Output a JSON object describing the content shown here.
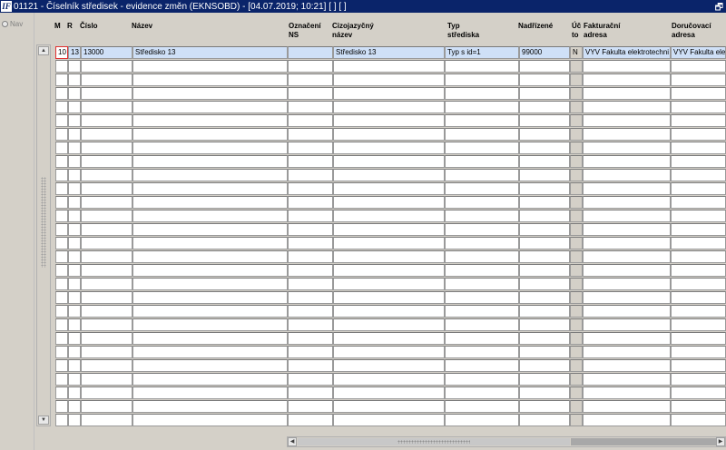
{
  "window": {
    "title": "01121 - Číselník středisek - evidence změn (EKNSOBD) - [04.07.2019; 10:21]  [ ]  [ ]",
    "app_icon": "IF",
    "restore_glyph": "🗗"
  },
  "nav": {
    "label": "Nav"
  },
  "columns": {
    "m": "M",
    "r": "R",
    "cislo": "Číslo",
    "nazev": "Název",
    "oznaceni": "Označení\nNS",
    "cizojazycny": "Cizojazyčný\nnázev",
    "typ": "Typ\nstřediska",
    "nadrizene": "Nadřízené",
    "ucto": "Úč\nto",
    "fakturacni": "Fakturační\nadresa",
    "dorucovaci": "Doručovací\nadresa"
  },
  "rows": [
    {
      "m": "10",
      "r": "13",
      "cislo": "13000",
      "nazev": "Středisko 13",
      "oznaceni": "",
      "cizojazycny": "Středisko 13",
      "typ": "Typ s id=1",
      "nadrizene": "99000",
      "ucto": "N",
      "fakturacni": "VYV Fakulta elektrotechni",
      "dorucovaci": "VYV Fakulta elek"
    }
  ],
  "empty_row_count": 27,
  "colors": {
    "titlebar": "#0a246a",
    "selected_row": "#cfe0f7",
    "focus_border": "#e03030",
    "background": "#d4d0c8"
  }
}
